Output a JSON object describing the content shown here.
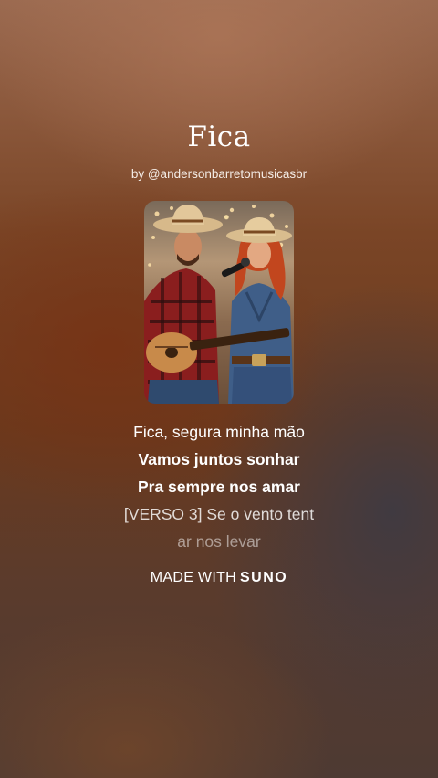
{
  "song": {
    "title": "Fica",
    "byline": "by @andersonbarretomusicasbr"
  },
  "lyrics": [
    "Fica, segura minha mão",
    "Vamos juntos sonhar",
    "Pra sempre nos amar",
    "[VERSO 3] Se o vento tent",
    "ar nos levar"
  ],
  "branding": {
    "made_with": "MADE WITH",
    "brand": "SUNO"
  },
  "icons": {
    "cover": "album-cover-art"
  }
}
